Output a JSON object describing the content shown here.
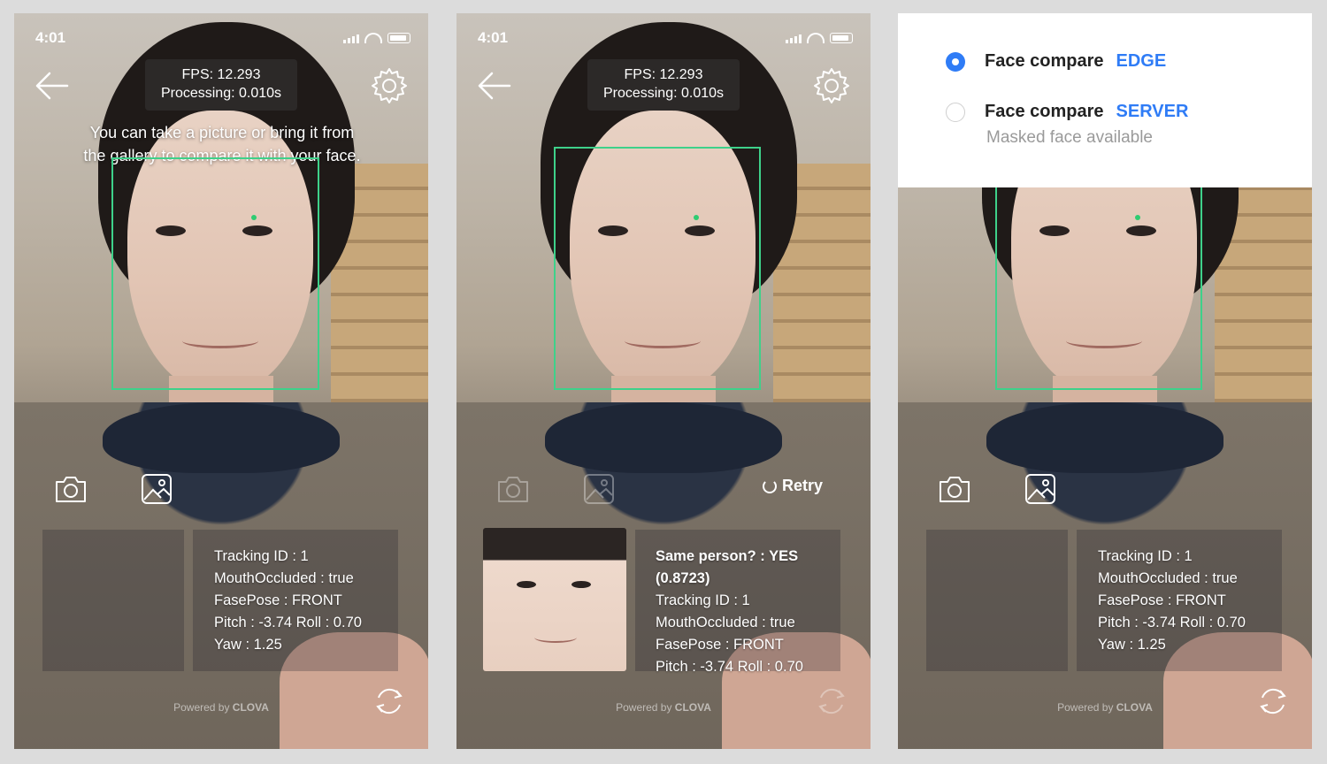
{
  "status": {
    "time": "4:01"
  },
  "fps": {
    "line1": "FPS: 12.293",
    "line2": "Processing: 0.010s"
  },
  "hint": {
    "line1": "You can take a picture or bring it from",
    "line2": "the gallery to compare it with your face."
  },
  "info_default": {
    "tracking": "Tracking ID : 1",
    "mouth": "MouthOccluded : true",
    "pose": "FasePose : FRONT",
    "pitch_roll": "Pitch : -3.74 Roll : 0.70",
    "yaw": "Yaw : 1.25"
  },
  "info_result": {
    "same_person": "Same person? : YES",
    "score": "(0.8723)",
    "tracking": "Tracking ID : 1",
    "mouth": "MouthOccluded : true",
    "pose": "FasePose : FRONT",
    "pitch_roll": "Pitch : -3.74 Roll : 0.70"
  },
  "retry": {
    "label": "Retry"
  },
  "powered": {
    "prefix": "Powered by ",
    "brand": "CLOVA"
  },
  "settings": {
    "options": [
      {
        "label": "Face compare",
        "tag": "EDGE",
        "selected": true
      },
      {
        "label": "Face compare",
        "tag": "SERVER",
        "selected": false,
        "sub": "Masked face available"
      }
    ]
  },
  "colors": {
    "accent": "#2f7cf6",
    "face_box": "#3ed18a"
  }
}
